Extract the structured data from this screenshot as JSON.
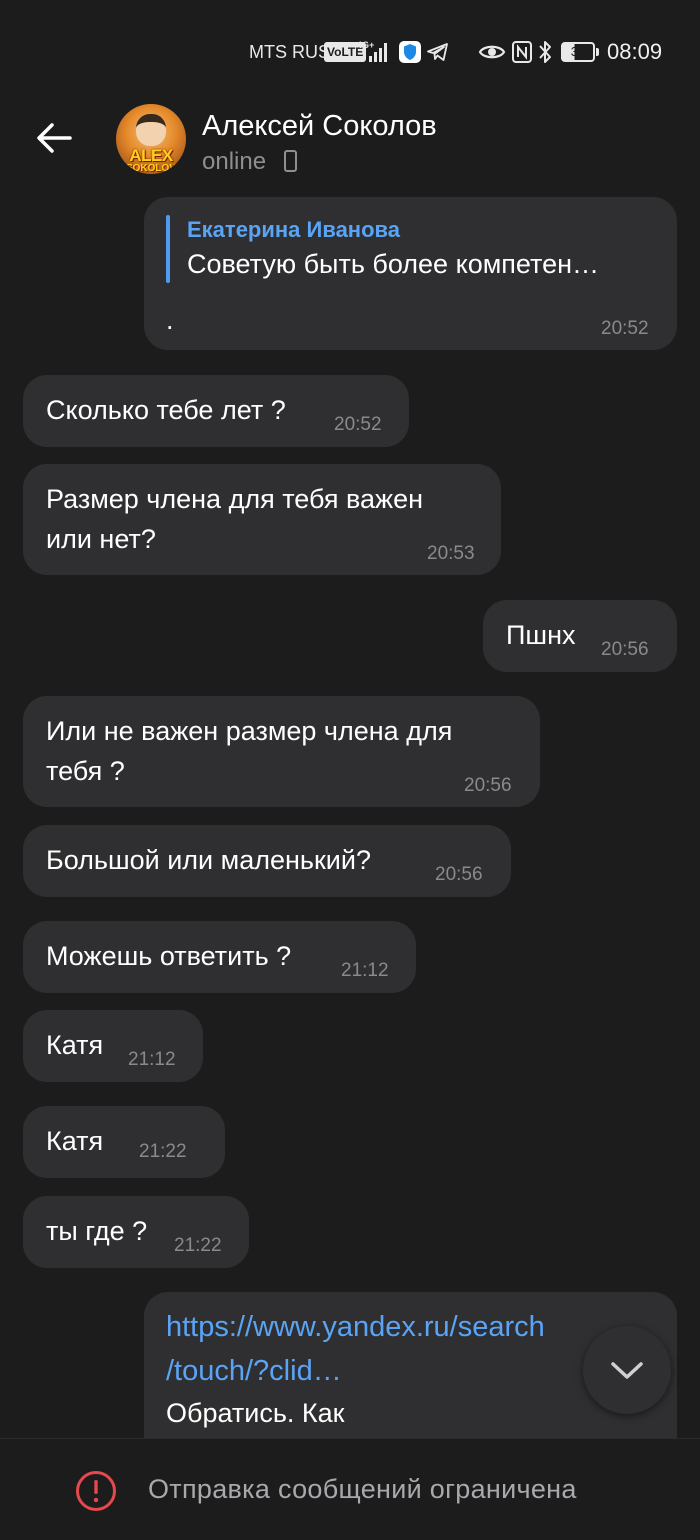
{
  "status_bar": {
    "carrier": "MTS RUS",
    "volte": "VoLTE",
    "network": "4G+",
    "battery": "38",
    "time": "08:09"
  },
  "header": {
    "contact_name": "Алексей Соколов",
    "status": "online",
    "avatar_text": "ALEX",
    "avatar_subtext": "SOKOLOV"
  },
  "messages": [
    {
      "direction": "outgoing",
      "reply_to": {
        "author": "Екатерина Иванова",
        "text": "Советую быть более компетен…"
      },
      "text": ".",
      "time": "20:52"
    },
    {
      "direction": "incoming",
      "text": "Сколько тебе лет ?",
      "time": "20:52"
    },
    {
      "direction": "incoming",
      "lines": [
        "Размер члена для тебя важен",
        "или нет?"
      ],
      "time": "20:53"
    },
    {
      "direction": "outgoing",
      "text": "Пшнх",
      "time": "20:56"
    },
    {
      "direction": "incoming",
      "lines": [
        "Или не важен размер члена для",
        "тебя ?"
      ],
      "time": "20:56"
    },
    {
      "direction": "incoming",
      "text": "Большой или маленький?",
      "time": "20:56"
    },
    {
      "direction": "incoming",
      "text": "Можешь ответить ?",
      "time": "21:12"
    },
    {
      "direction": "incoming",
      "text": "Катя",
      "time": "21:12"
    },
    {
      "direction": "incoming",
      "text": "Катя",
      "time": "21:22"
    },
    {
      "direction": "incoming",
      "text": "ты где ?",
      "time": "21:22"
    },
    {
      "direction": "outgoing",
      "link_lines": [
        "https://www.yandex.ru/search",
        "/touch/?clid…"
      ],
      "text": "Обратись. Как"
    }
  ],
  "bottom_bar": {
    "restricted_text": "Отправка сообщений ограничена"
  },
  "colors": {
    "background": "#1c1c1d",
    "bubble": "#2f2f31",
    "link": "#5aa4f5",
    "warning": "#e5484d"
  }
}
